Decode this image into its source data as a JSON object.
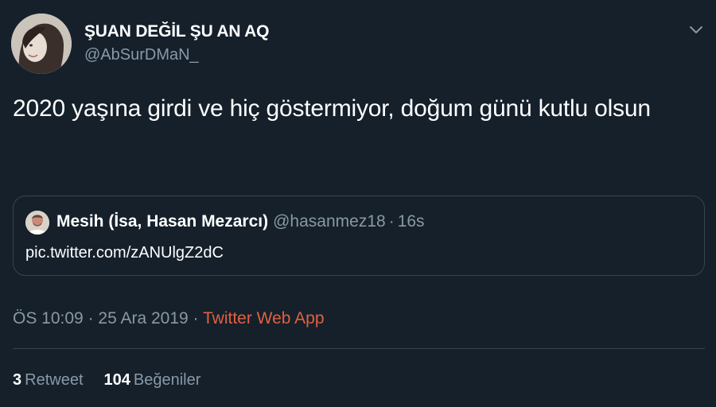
{
  "author": {
    "name": "ŞUAN DEĞİL ŞU AN AQ",
    "handle": "@AbSurDMaN_"
  },
  "tweet": {
    "text": "2020 yaşına girdi ve hiç göstermiyor, doğum günü kutlu olsun"
  },
  "quoted_tweet": {
    "name": "Mesih (İsa, Hasan Mezarcı)",
    "handle": "@hasanmez18",
    "separator": "·",
    "time": "16s",
    "link": "pic.twitter.com/zANUlgZ2dC"
  },
  "meta": {
    "time": "ÖS 10:09",
    "separator": "·",
    "date": "25 Ara 2019",
    "separator2": "·",
    "source": "Twitter Web App"
  },
  "stats": {
    "retweets_count": "3",
    "retweets_label": "Retweet",
    "likes_count": "104",
    "likes_label": "Beğeniler"
  },
  "colors": {
    "background": "#15202b",
    "secondary_text": "#8899a6",
    "border": "#38444d",
    "source_link": "#e0613f"
  },
  "icons": {
    "caret": "chevron-down-icon"
  }
}
